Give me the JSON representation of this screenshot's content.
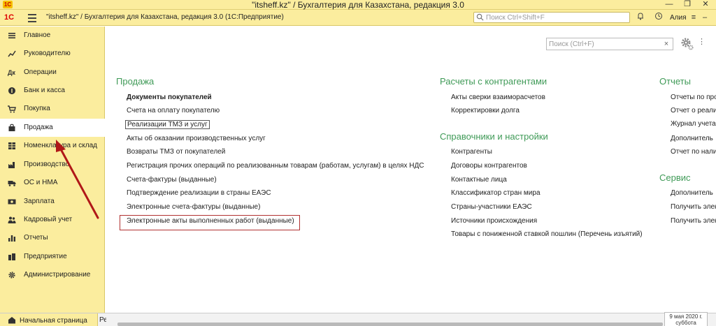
{
  "window": {
    "title": "\"itsheff.kz\" / Бухгалтерия для Казахстана, редакция 3.0"
  },
  "toolbar": {
    "logo": "1С",
    "title": "\"itsheff.kz\" / Бухгалтерия для Казахстана, редакция 3.0  (1С:Предприятие)",
    "search_placeholder": "Поиск Ctrl+Shift+F",
    "user": "Алия"
  },
  "sidebar": {
    "items": [
      {
        "label": "Главное",
        "icon": "list-icon"
      },
      {
        "label": "Руководителю",
        "icon": "chart-icon"
      },
      {
        "label": "Операции",
        "icon": "operations-icon"
      },
      {
        "label": "Банк и касса",
        "icon": "bank-icon"
      },
      {
        "label": "Покупка",
        "icon": "cart-icon"
      },
      {
        "label": "Продажа",
        "icon": "bag-icon",
        "active": true
      },
      {
        "label": "Номенклатура и склад",
        "icon": "warehouse-icon"
      },
      {
        "label": "Производство",
        "icon": "factory-icon"
      },
      {
        "label": "ОС и НМА",
        "icon": "truck-icon"
      },
      {
        "label": "Зарплата",
        "icon": "money-icon"
      },
      {
        "label": "Кадровый учет",
        "icon": "people-icon"
      },
      {
        "label": "Отчеты",
        "icon": "bar-chart-icon"
      },
      {
        "label": "Предприятие",
        "icon": "enterprise-icon"
      },
      {
        "label": "Администрирование",
        "icon": "gear-icon"
      }
    ]
  },
  "main": {
    "search_placeholder": "Поиск (Ctrl+F)",
    "sales": {
      "title": "Продажа",
      "links": [
        "Документы покупателей",
        "Счета на оплату покупателю",
        "Реализации ТМЗ и услуг",
        "Акты об оказании производственных услуг",
        "Возвраты ТМЗ от покупателей",
        "Регистрация прочих операций по реализованным товарам (работам, услугам) в целях НДС",
        "Счета-фактуры (выданные)",
        "Подтверждение реализации в страны ЕАЭС",
        "Электронные счета-фактуры (выданные)",
        "Электронные акты выполненных работ (выданные)"
      ]
    },
    "settlements": {
      "title": "Расчеты с контрагентами",
      "links": [
        "Акты сверки взаиморасчетов",
        "Корректировки долга"
      ]
    },
    "references": {
      "title": "Справочники и настройки",
      "links": [
        "Контрагенты",
        "Договоры контрагентов",
        "Контактные лица",
        "Классификатор стран мира",
        "Страны-участники ЕАЭС",
        "Источники происхождения",
        "Товары с пониженной ставкой пошлин (Перечень изъятий)"
      ]
    },
    "reports": {
      "title": "Отчеты",
      "links": [
        "Отчеты по про",
        "Отчет о реали",
        "Журнал учета",
        "Дополнитель",
        "Отчет по нали"
      ]
    },
    "service": {
      "title": "Сервис",
      "links": [
        "Дополнитель",
        "Получить элек",
        "Получить элек"
      ]
    }
  },
  "bottom": {
    "home_tab": "Начальная страница",
    "second_tab": "Ре",
    "date_line1": "9 мая 2020 г.",
    "date_line2": "суббота"
  },
  "colors": {
    "panel": "#fbed9e",
    "section_title": "#3f9a57",
    "highlight": "#b03030"
  }
}
